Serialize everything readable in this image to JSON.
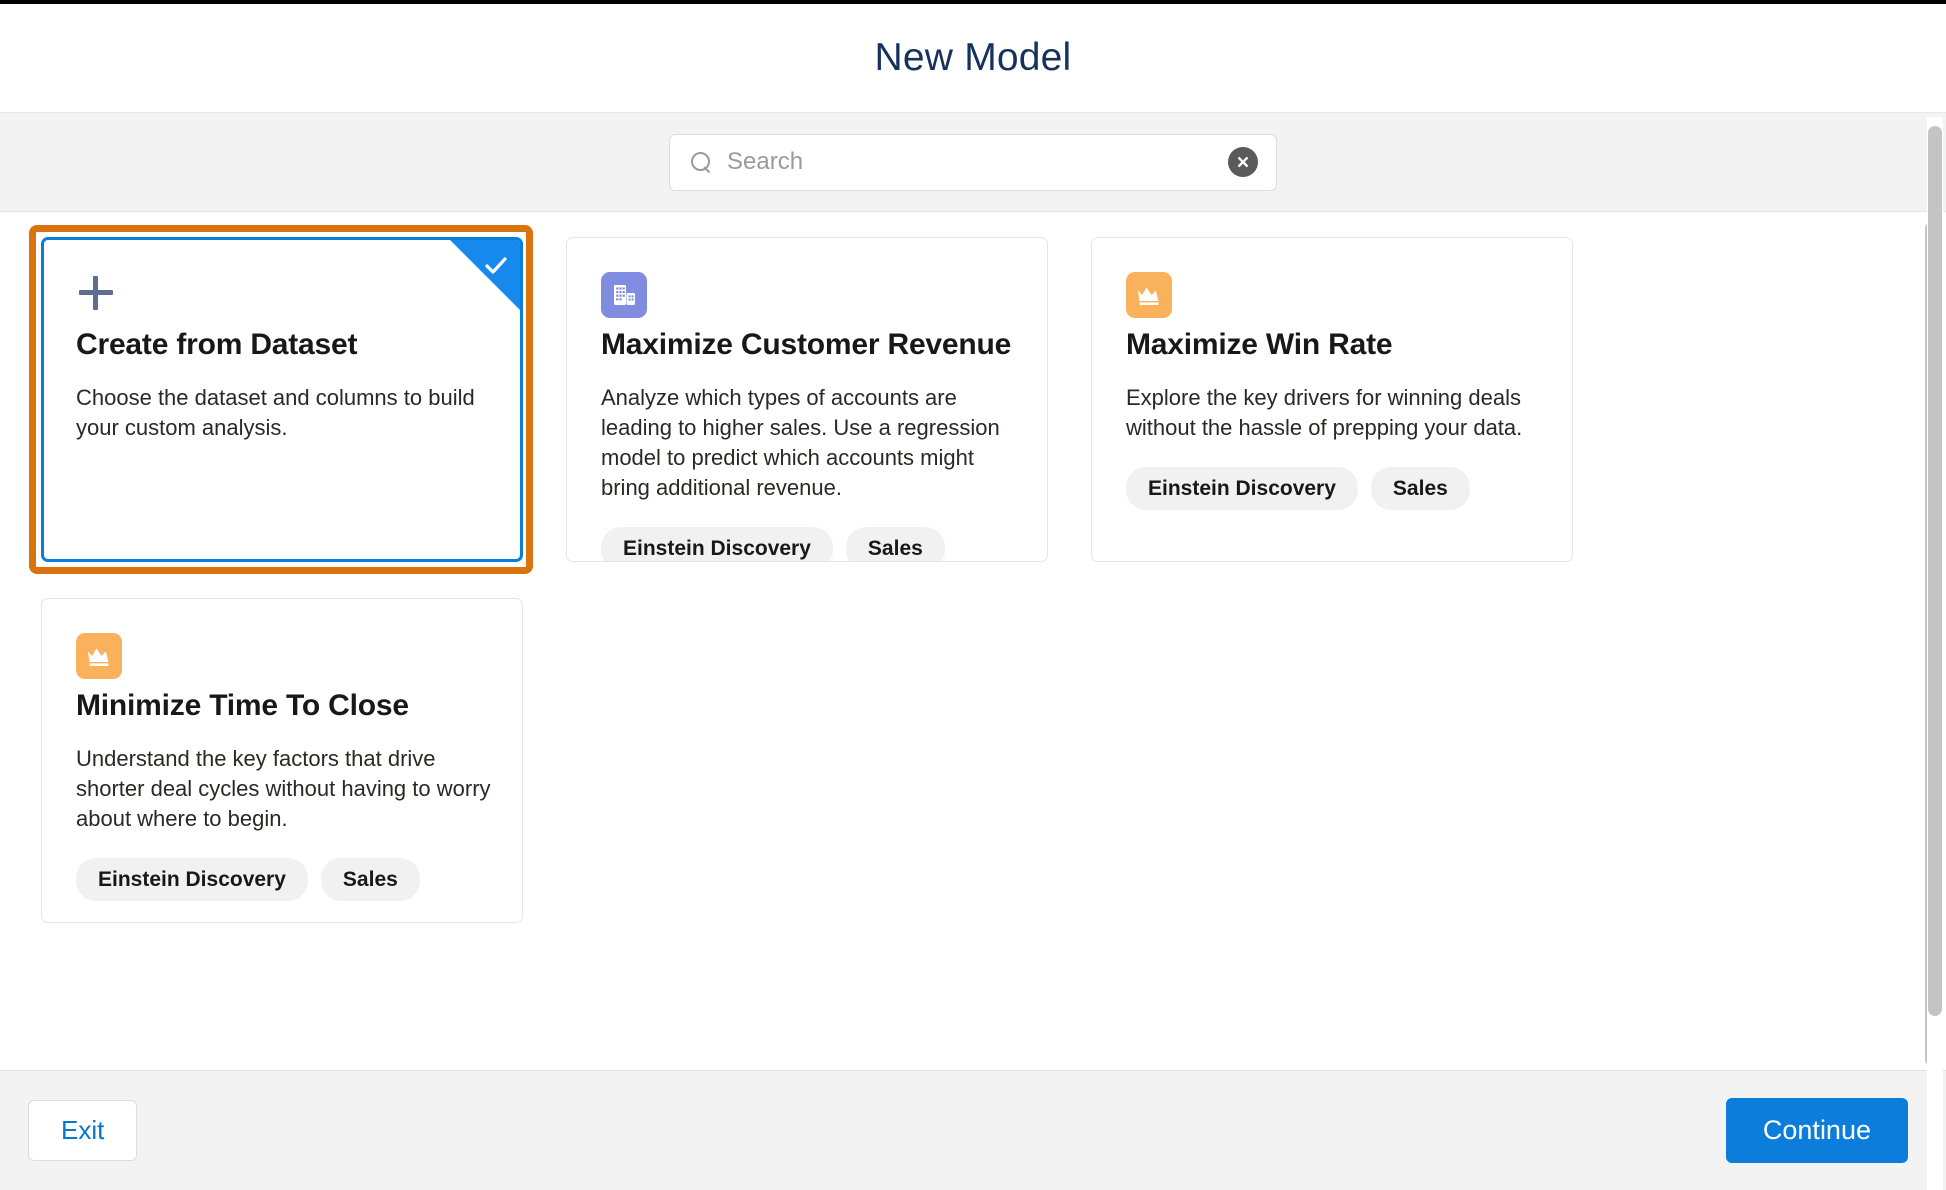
{
  "header": {
    "title": "New Model"
  },
  "search": {
    "placeholder": "Search",
    "value": "",
    "clear_label": "",
    "icon": "search-icon",
    "clear_icon": "clear-circle-icon"
  },
  "cards": [
    {
      "title": "Create from Dataset",
      "description": "Choose the dataset and columns to build your custom analysis.",
      "icon": "plus-icon",
      "icon_style": "plus",
      "icon_color": "#5c6f91",
      "selected": true,
      "highlighted": true,
      "tags": []
    },
    {
      "title": "Maximize Customer Revenue",
      "description": "Analyze which types of accounts are leading to higher sales. Use a regression model to predict which accounts might bring additional revenue.",
      "icon": "building-icon",
      "icon_style": "building",
      "icon_color": "#7f8ce0",
      "selected": false,
      "highlighted": false,
      "tags": [
        "Einstein Discovery",
        "Sales"
      ]
    },
    {
      "title": "Maximize Win Rate",
      "description": "Explore the key drivers for winning deals without the hassle of prepping your data.",
      "icon": "crown-icon",
      "icon_style": "crown",
      "icon_color": "#f9b15b",
      "selected": false,
      "highlighted": false,
      "tags": [
        "Einstein Discovery",
        "Sales"
      ]
    },
    {
      "title": "Minimize Time To Close",
      "description": "Understand the key factors that drive shorter deal cycles without having to worry about where to begin.",
      "icon": "crown-icon",
      "icon_style": "crown",
      "icon_color": "#f9b15b",
      "selected": false,
      "highlighted": false,
      "tags": [
        "Einstein Discovery",
        "Sales"
      ]
    }
  ],
  "footer": {
    "exit_label": "Exit",
    "continue_label": "Continue"
  },
  "colors": {
    "accent_blue": "#0d7ddb",
    "highlight_orange": "#d9730d",
    "title_navy": "#16325c",
    "strip_gray": "#f3f3f3"
  }
}
